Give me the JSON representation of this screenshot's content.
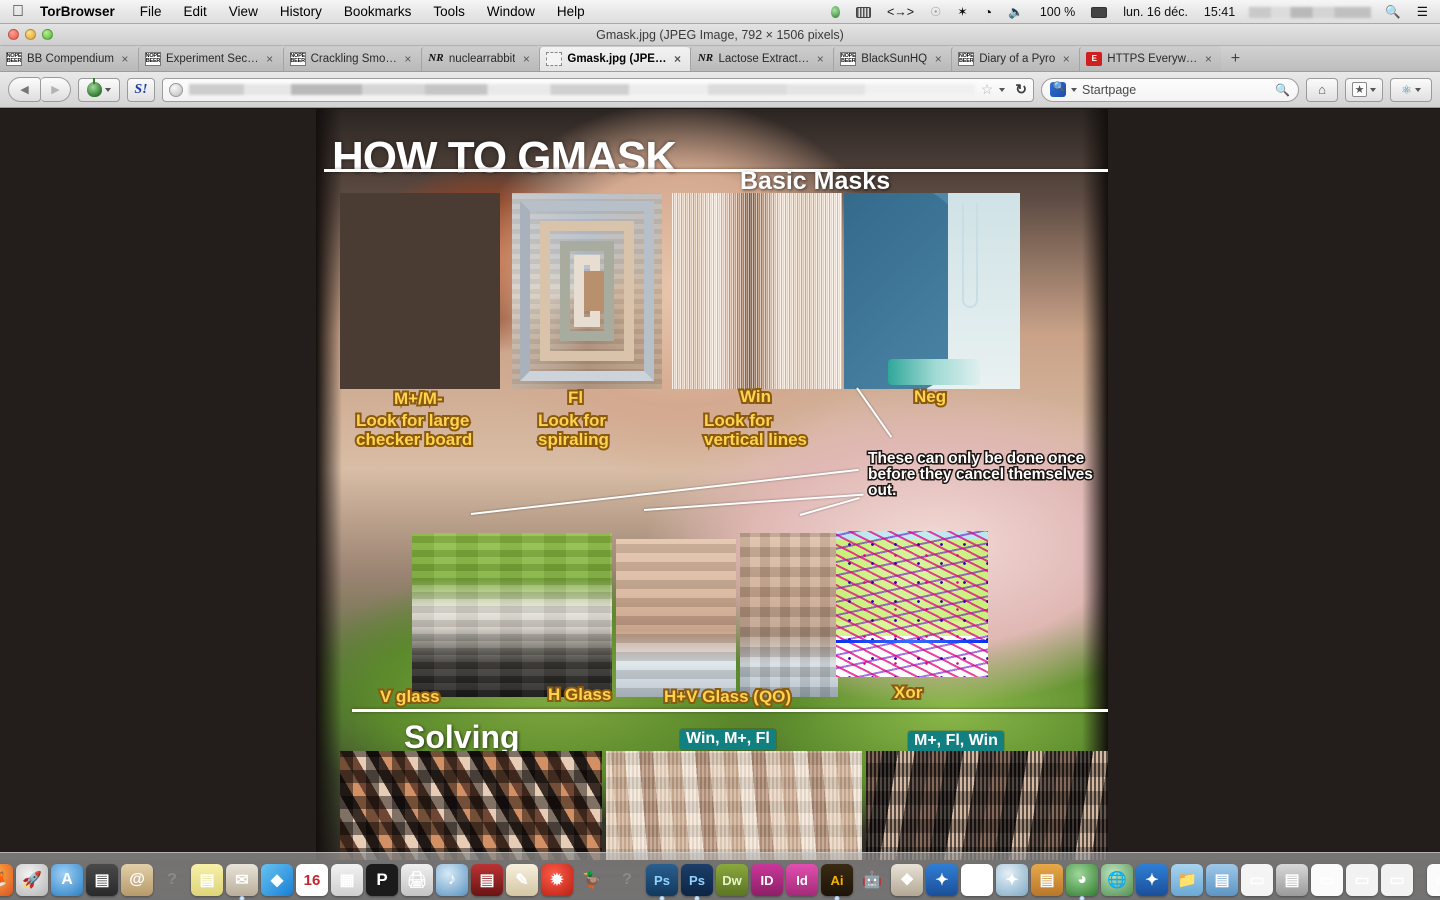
{
  "menubar": {
    "apple_icon": "apple-logo",
    "app_name": "TorBrowser",
    "items": [
      "File",
      "Edit",
      "View",
      "History",
      "Bookmarks",
      "Tools",
      "Window",
      "Help"
    ],
    "status": {
      "onion_icon": "onion-icon",
      "battery_icon": "battery-icon",
      "code_icon": "angle-brackets-icon",
      "clock_icon": "clock-icon",
      "bluetooth_icon": "bluetooth-icon",
      "wifi_icon": "wifi-icon",
      "volume_icon": "volume-icon",
      "battery_percent": "100 %",
      "plug_icon": "power-plug-icon",
      "date": "lun. 16 déc.",
      "time": "15:41",
      "user_name_blurred": "",
      "spotlight_icon": "search-icon",
      "notification_icon": "notification-center-icon"
    }
  },
  "window": {
    "title": "Gmask.jpg (JPEG Image, 792 × 1506 pixels)",
    "traffic_lights": [
      "close",
      "minimize",
      "zoom"
    ]
  },
  "tabs": [
    {
      "label": "BB Compendium",
      "favicon": "nope-beer-icon",
      "active": false,
      "close": "×"
    },
    {
      "label": "Experiment Sec…",
      "favicon": "nope-beer-icon",
      "active": false,
      "close": "×"
    },
    {
      "label": "Crackling Smo…",
      "favicon": "nope-beer-icon",
      "active": false,
      "close": "×"
    },
    {
      "label": "nuclearrabbit",
      "favicon": "nr-icon",
      "active": false,
      "close": "×"
    },
    {
      "label": "Gmask.jpg (JPE…",
      "favicon": "document-icon",
      "active": true,
      "close": "×"
    },
    {
      "label": "Lactose Extract…",
      "favicon": "nr-icon",
      "active": false,
      "close": "×"
    },
    {
      "label": "BlackSunHQ",
      "favicon": "nope-beer-icon",
      "active": false,
      "close": "×"
    },
    {
      "label": "Diary of a Pyro",
      "favicon": "nope-beer-icon",
      "active": false,
      "close": "×"
    },
    {
      "label": "HTTPS Everyw…",
      "favicon": "https-everywhere-icon",
      "active": false,
      "close": "×"
    }
  ],
  "new_tab_label": "+",
  "toolbar": {
    "back_icon": "back-arrow-icon",
    "forward_icon": "forward-arrow-icon",
    "torbutton_icon": "onion-icon",
    "sbang_text": "S!",
    "url_value": "",
    "url_placeholder": "",
    "site_icon": "globe-icon",
    "bookmark_star_icon": "star-icon",
    "reload_icon": "reload-icon",
    "search_engine": "Startpage",
    "search_engine_icon": "startpage-icon",
    "search_placeholder": "Startpage",
    "search_icon": "magnifier-icon",
    "home_icon": "home-icon",
    "bookmarks_icon": "bookmarks-star-icon",
    "noscript_icon": "noscript-icon",
    "dropdown_icon": "chevron-down-icon"
  },
  "poster": {
    "title": "HOW TO GMASK",
    "section_basic": "Basic Masks",
    "section_solving": "Solving",
    "basic_labels": [
      {
        "head": "M+/M-",
        "body": "Look for large\nchecker board"
      },
      {
        "head": "Fl",
        "body": "Look for\nspiraling"
      },
      {
        "head": "Win",
        "body": "Look for\nvertical lines"
      },
      {
        "head": "Neg",
        "body": ""
      }
    ],
    "neg_note": "These can only be done once\nbefore they cancel themselves\nout.",
    "glass_labels": [
      "V glass",
      "H Glass",
      "H+V Glass (QO)",
      "Xor"
    ],
    "solving_labels": [
      "Win, M+, Fl",
      "M+, Fl, Win"
    ],
    "colors": {
      "label_fill": "#ffd34d",
      "label_stroke": "#8a5a10",
      "solve_label_bg": "#128080",
      "title_color": "#ffffff"
    }
  },
  "dock": {
    "items": [
      {
        "name": "finder-icon",
        "glyph": "☺",
        "bg": "linear-gradient(to bottom,#7fc3e8,#3f8fc4)",
        "running": true
      },
      {
        "name": "thunderbird-icon",
        "glyph": "✉",
        "bg": "radial-gradient(circle at 35% 30%,#bfe0f5,#3a6fa8)",
        "running": true
      },
      {
        "name": "firefox-icon",
        "glyph": "🦊",
        "bg": "radial-gradient(circle at 40% 32%,#ffb34d,#d9531e)",
        "running": false
      },
      {
        "name": "launchpad-icon",
        "glyph": "🚀",
        "bg": "radial-gradient(circle at 40% 32%,#f2f2f2,#b6b6b6)",
        "running": false
      },
      {
        "name": "app-store-icon",
        "glyph": "A",
        "bg": "radial-gradient(circle at 40% 32%,#9fd0f5,#2a7fc4)",
        "running": false
      },
      {
        "name": "android-tools-icon",
        "glyph": "▤",
        "bg": "linear-gradient(to bottom,#4a4a4a,#2a2a2a)",
        "running": false
      },
      {
        "name": "contacts-icon",
        "glyph": "@",
        "bg": "linear-gradient(to bottom,#e2cfa8,#b79a6a)",
        "running": false
      },
      {
        "name": "unknown-app-icon",
        "glyph": "?",
        "bg": "none",
        "running": false
      },
      {
        "name": "stickies-icon",
        "glyph": "▤",
        "bg": "linear-gradient(to bottom,#f7f0a8,#ded47a)",
        "running": false
      },
      {
        "name": "mail-icon",
        "glyph": "✉",
        "bg": "linear-gradient(to bottom,#e8e3d8,#b9ae9a)",
        "running": true
      },
      {
        "name": "dropbox-icon",
        "glyph": "◆",
        "bg": "linear-gradient(135deg,#67c3f2,#1a7fd4)",
        "running": false
      },
      {
        "name": "calendar-icon",
        "glyph": "16",
        "bg": "#ffffff",
        "running": false
      },
      {
        "name": "numbers-icon",
        "glyph": "▦",
        "bg": "linear-gradient(to bottom,#f2f2f2,#cfcfcf)",
        "running": false
      },
      {
        "name": "pages-icon",
        "glyph": "P",
        "bg": "#1b1b1b",
        "running": false
      },
      {
        "name": "printer-icon",
        "glyph": "🖨",
        "bg": "linear-gradient(to bottom,#efefef,#c4c4c4)",
        "running": false
      },
      {
        "name": "itunes-icon",
        "glyph": "♪",
        "bg": "radial-gradient(circle at 38% 30%,#d6eaf7,#5a92c0)",
        "running": false
      },
      {
        "name": "theater-icon",
        "glyph": "▤",
        "bg": "linear-gradient(to bottom,#b33,#6a1414)",
        "running": false
      },
      {
        "name": "textedit-icon",
        "glyph": "✎",
        "bg": "linear-gradient(to bottom,#f7f0dd,#d4c6a4)",
        "running": false
      },
      {
        "name": "tomato-timer-icon",
        "glyph": "✹",
        "bg": "radial-gradient(circle at 40% 32%,#ff5b47,#b81f14)",
        "running": false
      },
      {
        "name": "cyberduck-icon",
        "glyph": "🦆",
        "bg": "none",
        "running": false
      },
      {
        "name": "unknown-app2-icon",
        "glyph": "?",
        "bg": "none",
        "running": false
      },
      {
        "name": "photoshop-icon",
        "glyph": "Ps",
        "bg": "linear-gradient(to bottom,#2a5f8f,#12395e)",
        "running": true
      },
      {
        "name": "photoshop-cc-icon",
        "glyph": "Ps",
        "bg": "linear-gradient(to bottom,#1c3e68,#0d2545)",
        "running": true
      },
      {
        "name": "dreamweaver-icon",
        "glyph": "Dw",
        "bg": "linear-gradient(to bottom,#8aa83c,#5c7524)",
        "running": false
      },
      {
        "name": "indesign-icon",
        "glyph": "ID",
        "bg": "linear-gradient(to bottom,#c9379a,#8d1f68)",
        "running": false
      },
      {
        "name": "indesign-cc-icon",
        "glyph": "Id",
        "bg": "linear-gradient(to bottom,#e24fb0,#a32a78)",
        "running": false
      },
      {
        "name": "illustrator-icon",
        "glyph": "Ai",
        "bg": "linear-gradient(to bottom,#3a2a14,#1d1408)",
        "running": true
      },
      {
        "name": "automator-icon",
        "glyph": "🤖",
        "bg": "none",
        "running": false
      },
      {
        "name": "iphoto-icon",
        "glyph": "❖",
        "bg": "linear-gradient(to bottom,#e9e2d6,#b3a894)",
        "running": false
      },
      {
        "name": "audacity-icon",
        "glyph": "✦",
        "bg": "linear-gradient(to bottom,#2f7fd4,#1a4f9a)",
        "running": false
      },
      {
        "name": "document-icon",
        "glyph": "▯",
        "bg": "#ffffff",
        "running": false
      },
      {
        "name": "safari-icon",
        "glyph": "✦",
        "bg": "radial-gradient(circle at 38% 30%,#e4f0f7,#7fa8c4)",
        "running": false
      },
      {
        "name": "utility-icon",
        "glyph": "▤",
        "bg": "linear-gradient(to bottom,#e8a94a,#b8772a)",
        "running": false
      },
      {
        "name": "tor-icon",
        "glyph": "◕",
        "bg": "radial-gradient(circle at 40% 32%,#9fd89a,#2f7a2e)",
        "running": true
      },
      {
        "name": "vidalia-icon",
        "glyph": "🌐",
        "bg": "radial-gradient(circle at 38% 30%,#bfe3bf,#4f8f4f)",
        "running": false
      },
      {
        "name": "audacity2-icon",
        "glyph": "✦",
        "bg": "linear-gradient(to bottom,#2f7fd4,#1a4f9a)",
        "running": false
      },
      {
        "name": "folder-icon",
        "glyph": "📁",
        "bg": "linear-gradient(to bottom,#a8d4ef,#6aa8d4)",
        "running": false
      },
      {
        "name": "windows-folder-icon",
        "glyph": "▤",
        "bg": "linear-gradient(to bottom,#9ec8e8,#5d95c4)",
        "running": false
      },
      {
        "name": "doc-window-icon",
        "glyph": "▭",
        "bg": "#f4f4f4",
        "running": false
      },
      {
        "name": "archive-icon",
        "glyph": "▤",
        "bg": "linear-gradient(to bottom,#d8d8d8,#9a9a9a)",
        "running": false
      },
      {
        "name": "doc-window2-icon",
        "glyph": "▭",
        "bg": "#fbfbfb",
        "running": false
      },
      {
        "name": "doc-window3-icon",
        "glyph": "▭",
        "bg": "#f2f2f2",
        "running": false
      },
      {
        "name": "doc-window4-icon",
        "glyph": "▭",
        "bg": "#f2f2f2",
        "running": false
      },
      {
        "name": "doc-window5-icon",
        "glyph": "▭",
        "bg": "#fbfbfb",
        "running": false
      },
      {
        "name": "doc-window6-icon",
        "glyph": "▭",
        "bg": "#f2f2f2",
        "running": false
      },
      {
        "name": "trash-icon",
        "glyph": "🗑",
        "bg": "linear-gradient(to bottom,#e4e4e4,#a8a8a8)",
        "running": false
      }
    ]
  }
}
